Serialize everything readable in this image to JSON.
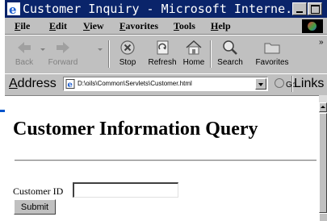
{
  "window": {
    "title": "Customer Inquiry - Microsoft Interne..."
  },
  "menu": {
    "items": [
      "File",
      "Edit",
      "View",
      "Favorites",
      "Tools",
      "Help"
    ]
  },
  "toolbar": {
    "back_label": "Back",
    "forward_label": "Forward",
    "stop_label": "Stop",
    "refresh_label": "Refresh",
    "home_label": "Home",
    "search_label": "Search",
    "favorites_label": "Favorites",
    "more": "»"
  },
  "address": {
    "label": "Address",
    "url": "D:\\oils\\Common\\Servlets\\Customer.html",
    "go_label": "Go",
    "links_label": "Links"
  },
  "page": {
    "heading": "Customer Information Query",
    "field_label": "Customer ID",
    "customer_id_value": "",
    "submit_label": "Submit"
  },
  "colors": {
    "title_bar": "#0a246a",
    "chrome": "#c0c0c0",
    "content_bg": "#ffffff"
  }
}
